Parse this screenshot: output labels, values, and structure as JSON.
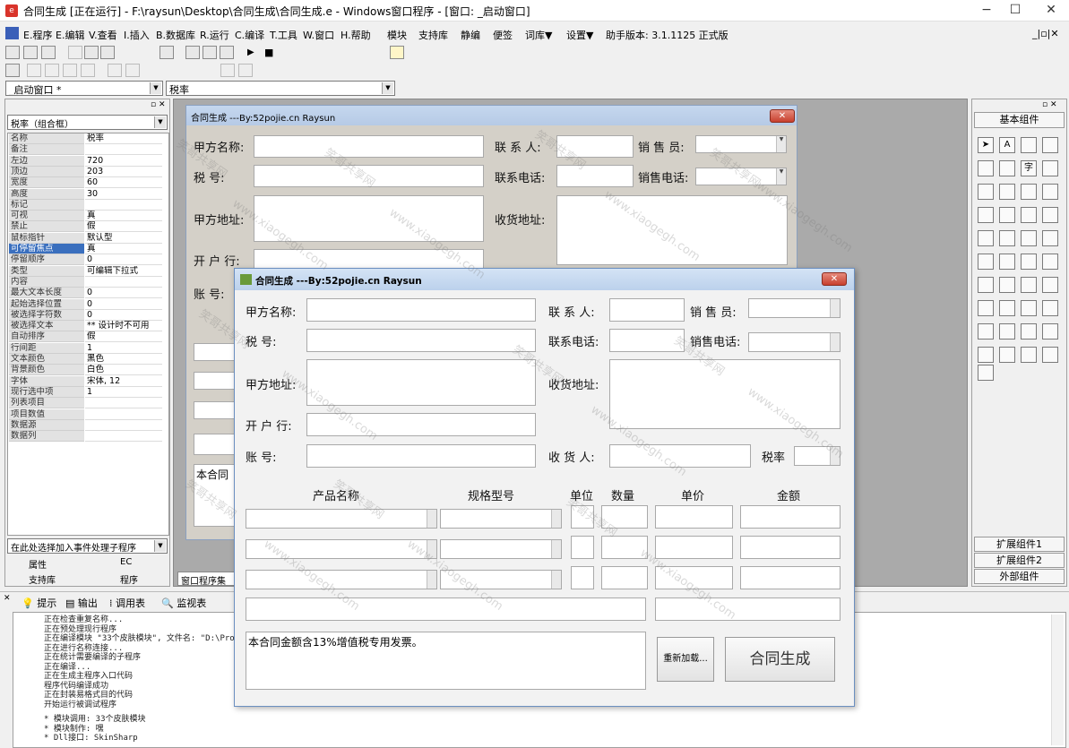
{
  "app": {
    "title": "合同生成 [正在运行] - F:\\raysun\\Desktop\\合同生成\\合同生成.e - Windows窗口程序 - [窗口: _启动窗口]",
    "minimize": "−",
    "maximize": "☐",
    "close": "✕"
  },
  "menu": {
    "items": [
      "E.程序",
      "E.编辑",
      "V.查看",
      "I.插入",
      "B.数据库",
      "R.运行",
      "C.编译",
      "T.工具",
      "W.窗口",
      "H.帮助",
      "模块",
      "支持库",
      "静编",
      "便签",
      "词库▼",
      "设置▼",
      "助手版本: 3.1.1125 正式版"
    ],
    "right": "_|▫|✕"
  },
  "toolbar": {
    "window_combo": "_启动窗口 *",
    "prop_combo": "税率"
  },
  "left_panel": {
    "header": "税率（组合框）",
    "props": [
      {
        "k": "名称",
        "v": "税率"
      },
      {
        "k": "备注",
        "v": ""
      },
      {
        "k": "左边",
        "v": "720"
      },
      {
        "k": "顶边",
        "v": "203"
      },
      {
        "k": "宽度",
        "v": "60"
      },
      {
        "k": "高度",
        "v": "30"
      },
      {
        "k": "标记",
        "v": ""
      },
      {
        "k": "可视",
        "v": "真"
      },
      {
        "k": "禁止",
        "v": "假"
      },
      {
        "k": "鼠标指针",
        "v": "默认型"
      },
      {
        "k": "可停留焦点",
        "v": "真"
      },
      {
        "k": "停留顺序",
        "v": "0"
      },
      {
        "k": "类型",
        "v": "可编辑下拉式"
      },
      {
        "k": "内容",
        "v": ""
      },
      {
        "k": "最大文本长度",
        "v": "0"
      },
      {
        "k": "起始选择位置",
        "v": "0"
      },
      {
        "k": "被选择字符数",
        "v": "0"
      },
      {
        "k": "被选择文本",
        "v": "** 设计时不可用"
      },
      {
        "k": "自动排序",
        "v": "假"
      },
      {
        "k": "行间距",
        "v": "1"
      },
      {
        "k": "文本颜色",
        "v": "黑色"
      },
      {
        "k": "背景颜色",
        "v": "白色"
      },
      {
        "k": "字体",
        "v": "宋体, 12"
      },
      {
        "k": "现行选中项",
        "v": "1"
      },
      {
        "k": "列表项目",
        "v": ""
      },
      {
        "k": "项目数值",
        "v": ""
      },
      {
        "k": "数据源",
        "v": ""
      },
      {
        "k": "数据列",
        "v": ""
      }
    ],
    "event_combo": "在此处选择加入事件处理子程序",
    "tabs": [
      "属性",
      "EC",
      "支持库",
      "程序"
    ]
  },
  "design_tab": "窗口程序集",
  "bottom_tabs": [
    "提示",
    "输出",
    "调用表",
    "监视表"
  ],
  "output_lines": [
    "正在检查重复名称...",
    "正在预处理现行程序",
    "正在编译模块 \"33个皮肤模块\", 文件名: \"D:\\Prog",
    "正在进行名称连接...",
    "正在统计需要编译的子程序",
    "正在编译...",
    "正在生成主程序入口代码",
    "程序代码编译成功",
    "正在封装易格式目的代码",
    "开始运行被调试程序",
    "* 模块调用: 33个皮肤模块",
    "* 模块制作: 嘿",
    "* Dll接口: SkinSharp"
  ],
  "right_panel": {
    "header": "基本组件",
    "ext1": "扩展组件1",
    "ext2": "扩展组件2",
    "ext3": "外部组件"
  },
  "form": {
    "title": "合同生成 ---By:52pojie.cn Raysun",
    "lbl_company": "甲方名称:",
    "lbl_contact": "联 系 人:",
    "lbl_sales": "销 售 员:",
    "lbl_tax": "税    号:",
    "lbl_phone": "联系电话:",
    "lbl_salesphone": "销售电话:",
    "lbl_addr": "甲方地址:",
    "lbl_ship": "收货地址:",
    "lbl_bank": "开 户 行:",
    "lbl_acct": "账    号:",
    "lbl_receiver": "收 货 人:",
    "lbl_rate": "税率",
    "col_product": "产品名称",
    "col_spec": "规格型号",
    "col_unit": "单位",
    "col_qty": "数量",
    "col_price": "单价",
    "col_amount": "金额",
    "note": "本合同金额含13%增值税专用发票。",
    "note_short": "本合同",
    "reload": "重新加载...",
    "generate": "合同生成"
  },
  "watermark": {
    "text1": "笑哥共享网",
    "text2": "www.xiaogegh.com"
  }
}
